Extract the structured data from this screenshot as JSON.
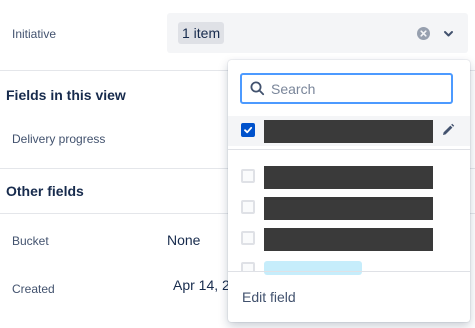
{
  "fields": {
    "initiative_label": "Initiative",
    "initiative_value": "1 item",
    "fields_in_view_title": "Fields in this view",
    "delivery_progress_label": "Delivery progress",
    "other_fields_title": "Other fields",
    "bucket_label": "Bucket",
    "bucket_value": "None",
    "created_label": "Created",
    "created_value": "Apr 14, 2"
  },
  "dropdown": {
    "search_placeholder": "Search",
    "search_value": "",
    "options": [
      {
        "checked": true
      },
      {
        "checked": false
      },
      {
        "checked": false
      },
      {
        "checked": false
      }
    ],
    "edit_field_label": "Edit field"
  },
  "icons": {
    "clear": "clear-icon",
    "chevron": "chevron-down-icon",
    "search": "search-icon",
    "edit": "pencil-icon"
  },
  "colors": {
    "accent": "#0052cc",
    "focus_ring": "#4c9aff",
    "redaction": "#3a3a3a"
  }
}
